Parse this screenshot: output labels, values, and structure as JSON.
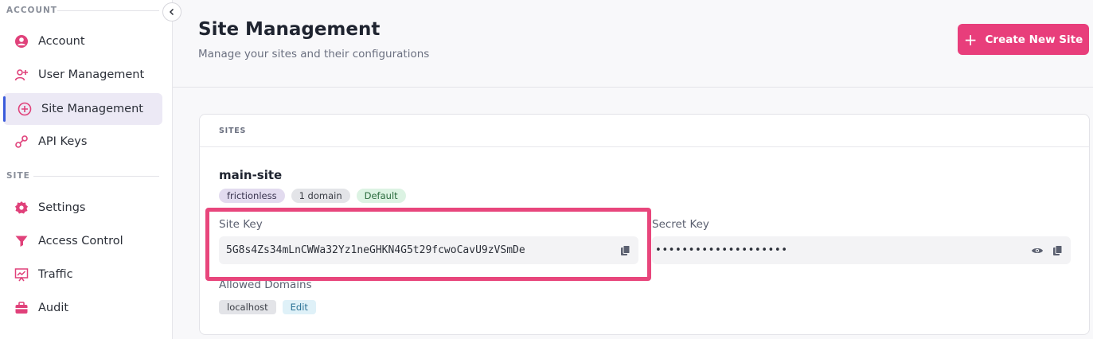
{
  "sidebar": {
    "sections": [
      {
        "label": "ACCOUNT"
      },
      {
        "label": "SITE"
      }
    ],
    "items": [
      {
        "label": "Account",
        "icon": "account-circle-icon"
      },
      {
        "label": "User Management",
        "icon": "user-add-icon"
      },
      {
        "label": "Site Management",
        "icon": "plus-circle-icon",
        "active": true
      },
      {
        "label": "API Keys",
        "icon": "key-link-icon"
      },
      {
        "label": "Settings",
        "icon": "gear-icon"
      },
      {
        "label": "Access Control",
        "icon": "filter-icon"
      },
      {
        "label": "Traffic",
        "icon": "chart-board-icon"
      },
      {
        "label": "Audit",
        "icon": "briefcase-icon"
      }
    ]
  },
  "header": {
    "title": "Site Management",
    "subtitle": "Manage your sites and their configurations",
    "create_button": "Create New Site"
  },
  "card": {
    "section_label": "SITES",
    "site": {
      "name": "main-site",
      "badges": [
        "frictionless",
        "1 domain",
        "Default"
      ],
      "site_key_label": "Site Key",
      "site_key": "5G8s4Zs34mLnCWWa32Yz1neGHKN4G5t29fcwoCavU9zVSmDe",
      "secret_key_label": "Secret Key",
      "secret_key_masked": "••••••••••••••••••••",
      "allowed_domains_label": "Allowed Domains",
      "domains": [
        "localhost"
      ],
      "edit_label": "Edit"
    }
  },
  "colors": {
    "accent": "#e83e7b",
    "active_bar": "#3b5bdb",
    "icon_pink": "#e0417a"
  }
}
